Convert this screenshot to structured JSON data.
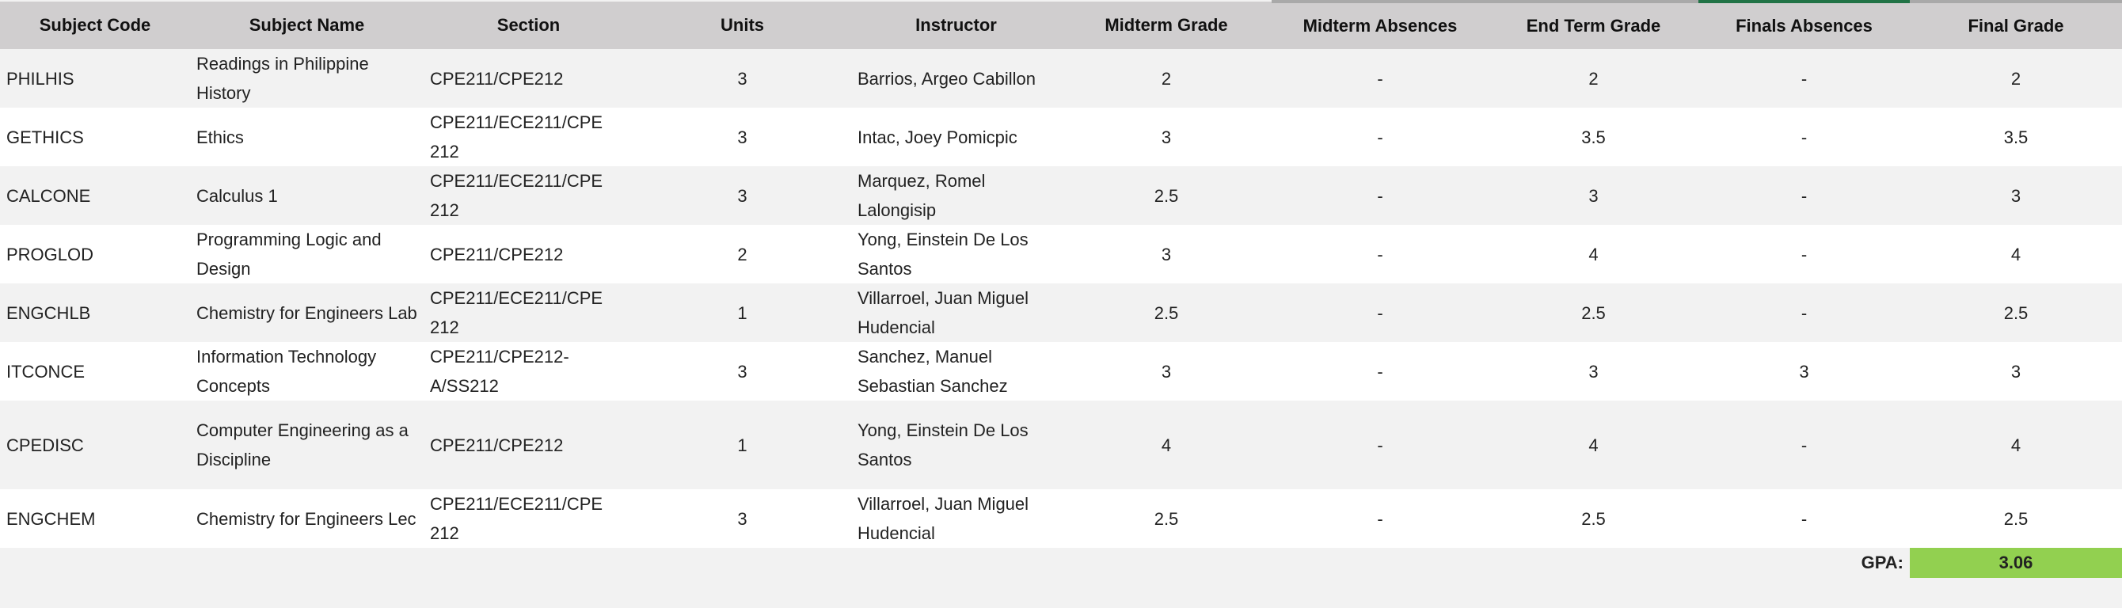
{
  "headers": [
    "Subject Code",
    "Subject Name",
    "Section",
    "Units",
    "Instructor",
    "Midterm Grade",
    "Midterm Absences",
    "End Term Grade",
    "Finals Absences",
    "Final Grade"
  ],
  "rows": [
    [
      "PHILHIS",
      "Readings in Philippine History",
      "CPE211/CPE212",
      "3",
      "Barrios, Argeo Cabillon",
      "2",
      "-",
      "2",
      "-",
      "2"
    ],
    [
      "GETHICS",
      "Ethics",
      "CPE211/ECE211/CPE 212",
      "3",
      "Intac, Joey Pomicpic",
      "3",
      "-",
      "3.5",
      "-",
      "3.5"
    ],
    [
      "CALCONE",
      "Calculus 1",
      "CPE211/ECE211/CPE 212",
      "3",
      "Marquez, Romel Lalongisip",
      "2.5",
      "-",
      "3",
      "-",
      "3"
    ],
    [
      "PROGLOD",
      "Programming Logic and Design",
      "CPE211/CPE212",
      "2",
      "Yong, Einstein De Los Santos",
      "3",
      "-",
      "4",
      "-",
      "4"
    ],
    [
      "ENGCHLB",
      "Chemistry for Engineers Lab",
      "CPE211/ECE211/CPE 212",
      "1",
      "Villarroel, Juan Miguel Hudencial",
      "2.5",
      "-",
      "2.5",
      "-",
      "2.5"
    ],
    [
      "ITCONCE",
      "Information Technology Concepts",
      "CPE211/CPE212-A/SS212",
      "3",
      "Sanchez, Manuel Sebastian Sanchez",
      "3",
      "-",
      "3",
      "3",
      "3"
    ],
    [
      "CPEDISC",
      "Computer Engineering as a Discipline",
      "CPE211/CPE212",
      "1",
      "Yong, Einstein De Los Santos",
      "4",
      "-",
      "4",
      "-",
      "4"
    ],
    [
      "ENGCHEM",
      "Chemistry for Engineers Lec",
      "CPE211/ECE211/CPE 212",
      "3",
      "Villarroel, Juan Miguel Hudencial",
      "2.5",
      "-",
      "2.5",
      "-",
      "2.5"
    ]
  ],
  "gpa": {
    "label": "GPA:",
    "value": "3.06"
  },
  "colors": {
    "header": "#d0cecf",
    "gpa_highlight": "#92d050",
    "row_alt": "#f2f2f2"
  }
}
